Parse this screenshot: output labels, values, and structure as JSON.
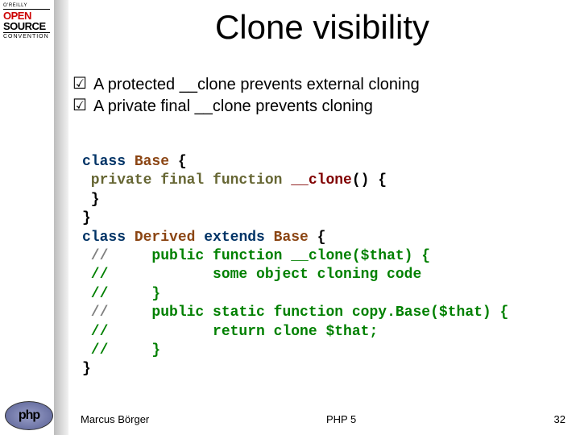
{
  "logo": {
    "top_small": "O'REILLY",
    "open": "OPEN",
    "source": "SOURCE",
    "conv": "CONVENTION"
  },
  "title": "Clone visibility",
  "bullets": [
    "A protected __clone prevents external cloning",
    "A private final __clone prevents cloning"
  ],
  "code_lines": [
    [
      {
        "t": "class ",
        "c": "kw-navy"
      },
      {
        "t": "Base ",
        "c": "kw-brown"
      },
      {
        "t": "{",
        "c": ""
      }
    ],
    [
      {
        "t": " private final function ",
        "c": "kw-olive"
      },
      {
        "t": "__clone",
        "c": "kw-maroon"
      },
      {
        "t": "() {",
        "c": ""
      }
    ],
    [
      {
        "t": " }",
        "c": ""
      }
    ],
    [
      {
        "t": "}",
        "c": ""
      }
    ],
    [
      {
        "t": "class ",
        "c": "kw-navy"
      },
      {
        "t": "Derived ",
        "c": "kw-brown"
      },
      {
        "t": "extends ",
        "c": "kw-navy"
      },
      {
        "t": "Base ",
        "c": "kw-brown"
      },
      {
        "t": "{",
        "c": ""
      }
    ],
    [
      {
        "t": " //     ",
        "c": "kw-gray"
      },
      {
        "t": "public function ",
        "c": "kw-green"
      },
      {
        "t": "__clone",
        "c": "kw-green"
      },
      {
        "t": "($that) {",
        "c": "kw-green"
      }
    ],
    [
      {
        "t": " //            some object cloning code",
        "c": "kw-green"
      }
    ],
    [
      {
        "t": " //     }",
        "c": "kw-green"
      }
    ],
    [
      {
        "t": " //     ",
        "c": "kw-gray"
      },
      {
        "t": "public static function ",
        "c": "kw-green"
      },
      {
        "t": "copy",
        "c": "kw-green"
      },
      {
        "t": ".",
        "c": "kw-green"
      },
      {
        "t": "Base",
        "c": "kw-green"
      },
      {
        "t": "($that) {",
        "c": "kw-green"
      }
    ],
    [
      {
        "t": " //            return clone $that;",
        "c": "kw-green"
      }
    ],
    [
      {
        "t": " //     }",
        "c": "kw-green"
      }
    ],
    [
      {
        "t": "}",
        "c": ""
      }
    ]
  ],
  "footer": {
    "left": "Marcus Börger",
    "center": "PHP 5",
    "right": "32"
  },
  "php_logo": "php"
}
